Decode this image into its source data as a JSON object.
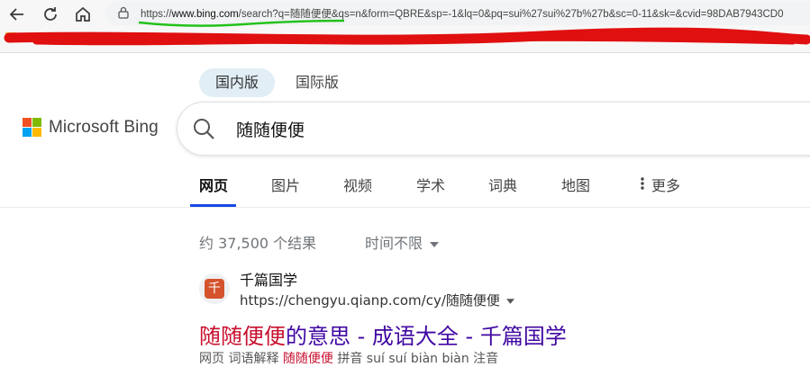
{
  "browser": {
    "url_prefix": "https://",
    "url_host": "www.bing.com",
    "url_rest": "/search?q=随随便便&qs=n&form=QBRE&sp=-1&lq=0&pq=sui%27sui%27b%27b&sc=0-11&sk=&cvid=98DAB7943CD0"
  },
  "logo": {
    "text": "Microsoft Bing"
  },
  "region_tabs": [
    "国内版",
    "国际版"
  ],
  "search": {
    "query": "随随便便"
  },
  "scopes": [
    "网页",
    "图片",
    "视频",
    "学术",
    "词典",
    "地图",
    "更多"
  ],
  "results_meta": {
    "count": "约 37,500 个结果",
    "time_filter": "时间不限"
  },
  "result": {
    "favicon_char": "千",
    "site_name": "千篇国学",
    "site_url": "https://chengyu.qianp.com/cy/随随便便",
    "title_highlight": "随随便便",
    "title_rest": "的意思 - 成语大全 - 千篇国学",
    "snippet_start": "网页 词语解释 ",
    "snippet_highlight": "随随便便",
    "snippet_rest": " 拼音 suí suí biàn biàn 注音"
  },
  "colors": {
    "link_title": "#4007a2",
    "highlight": "#c8102e",
    "scope_active": "#174ae4"
  }
}
